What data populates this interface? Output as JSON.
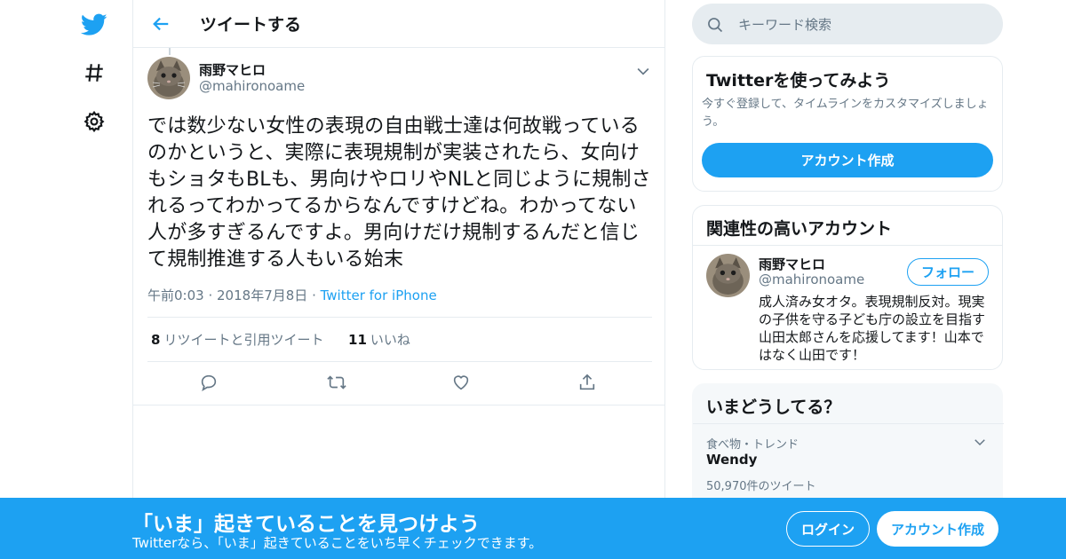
{
  "colors": {
    "accent": "#1da1f2",
    "text": "#14171a",
    "muted": "#657786",
    "border": "#e6ecf0"
  },
  "nav": {
    "items": [
      {
        "icon": "twitter-bird-icon"
      },
      {
        "icon": "hashtag-icon"
      },
      {
        "icon": "gear-icon"
      }
    ]
  },
  "header": {
    "title": "ツイートする"
  },
  "tweet": {
    "author": {
      "name": "雨野マヒロ",
      "handle": "@mahironoame"
    },
    "text": "では数少ない女性の表現の自由戦士達は何故戦っているのかというと、実際に表現規制が実装されたら、女向けもショタもBLも、男向けやロリやNLと同じように規制されるってわかってるからなんですけどね。わかってない人が多すぎるんですよ。男向けだけ規制するんだと信じて規制推進する人もいる始末",
    "time": "午前0:03",
    "date": "2018年7月8日",
    "source": "Twitter for iPhone",
    "retweets": "8",
    "retweets_label": "リツイートと引用ツイート",
    "likes": "11",
    "likes_label": "いいね"
  },
  "search": {
    "placeholder": "キーワード検索"
  },
  "signup_card": {
    "title": "Twitterを使ってみよう",
    "description": "今すぐ登録して、タイムラインをカスタマイズしましょう。",
    "button": "アカウント作成"
  },
  "related_card": {
    "title": "関連性の高いアカウント",
    "name": "雨野マヒロ",
    "handle": "@mahironoame",
    "follow_button": "フォロー",
    "bio": "成人済み女オタ。表現規制反対。現実の子供を守る子ども庁の設立を目指す山田太郎さんを応援してます！山本ではなく山田です！"
  },
  "trends_card": {
    "title": "いまどうしてる？",
    "category": "食べ物・トレンド",
    "topic": "Wendy",
    "count": "50,970件のツイート"
  },
  "banner": {
    "title": "「いま」起きていることを見つけよう",
    "subtitle": "Twitterなら、「いま」起きていることをいち早くチェックできます。",
    "login": "ログイン",
    "signup": "アカウント作成"
  }
}
